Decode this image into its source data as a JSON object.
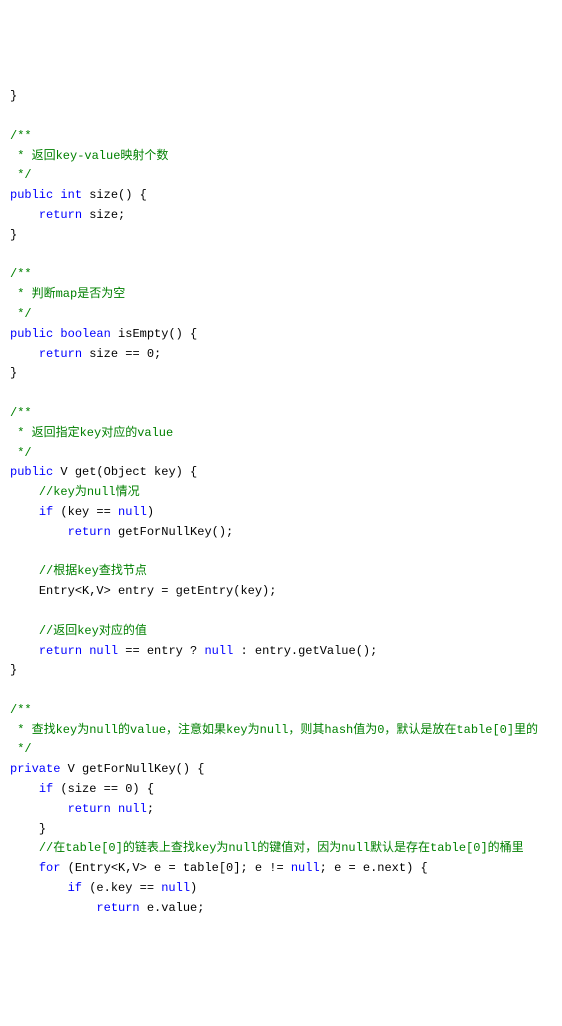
{
  "lines": [
    {
      "i": 0,
      "t": [
        {
          "c": "",
          "s": "}"
        }
      ]
    },
    {
      "i": 0,
      "t": []
    },
    {
      "i": 0,
      "t": [
        {
          "c": "cm",
          "s": "/**"
        }
      ]
    },
    {
      "i": 0,
      "t": [
        {
          "c": "cm",
          "s": " * 返回key-value映射个数"
        }
      ]
    },
    {
      "i": 0,
      "t": [
        {
          "c": "cm",
          "s": " */"
        }
      ]
    },
    {
      "i": 0,
      "t": [
        {
          "c": "kw",
          "s": "public"
        },
        {
          "c": "",
          "s": " "
        },
        {
          "c": "kw",
          "s": "int"
        },
        {
          "c": "",
          "s": " size() {"
        }
      ]
    },
    {
      "i": 1,
      "t": [
        {
          "c": "kw",
          "s": "return"
        },
        {
          "c": "",
          "s": " size;"
        }
      ]
    },
    {
      "i": 0,
      "t": [
        {
          "c": "",
          "s": "}"
        }
      ]
    },
    {
      "i": 0,
      "t": []
    },
    {
      "i": 0,
      "t": [
        {
          "c": "cm",
          "s": "/**"
        }
      ]
    },
    {
      "i": 0,
      "t": [
        {
          "c": "cm",
          "s": " * 判断map是否为空"
        }
      ]
    },
    {
      "i": 0,
      "t": [
        {
          "c": "cm",
          "s": " */"
        }
      ]
    },
    {
      "i": 0,
      "t": [
        {
          "c": "kw",
          "s": "public"
        },
        {
          "c": "",
          "s": " "
        },
        {
          "c": "kw",
          "s": "boolean"
        },
        {
          "c": "",
          "s": " isEmpty() {"
        }
      ]
    },
    {
      "i": 1,
      "t": [
        {
          "c": "kw",
          "s": "return"
        },
        {
          "c": "",
          "s": " size == 0;"
        }
      ]
    },
    {
      "i": 0,
      "t": [
        {
          "c": "",
          "s": "}"
        }
      ]
    },
    {
      "i": 0,
      "t": []
    },
    {
      "i": 0,
      "t": [
        {
          "c": "cm",
          "s": "/**"
        }
      ]
    },
    {
      "i": 0,
      "t": [
        {
          "c": "cm",
          "s": " * 返回指定key对应的value"
        }
      ]
    },
    {
      "i": 0,
      "t": [
        {
          "c": "cm",
          "s": " */"
        }
      ]
    },
    {
      "i": 0,
      "t": [
        {
          "c": "kw",
          "s": "public"
        },
        {
          "c": "",
          "s": " V get(Object key) {"
        }
      ]
    },
    {
      "i": 1,
      "t": [
        {
          "c": "cm",
          "s": "//key为null情况"
        }
      ]
    },
    {
      "i": 1,
      "t": [
        {
          "c": "kw",
          "s": "if"
        },
        {
          "c": "",
          "s": " (key == "
        },
        {
          "c": "kw",
          "s": "null"
        },
        {
          "c": "",
          "s": ")"
        }
      ]
    },
    {
      "i": 2,
      "t": [
        {
          "c": "kw",
          "s": "return"
        },
        {
          "c": "",
          "s": " getForNullKey();"
        }
      ]
    },
    {
      "i": 0,
      "t": []
    },
    {
      "i": 1,
      "t": [
        {
          "c": "cm",
          "s": "//根据key查找节点"
        }
      ]
    },
    {
      "i": 1,
      "t": [
        {
          "c": "",
          "s": "Entry<K,V> entry = getEntry(key);"
        }
      ]
    },
    {
      "i": 0,
      "t": []
    },
    {
      "i": 1,
      "t": [
        {
          "c": "cm",
          "s": "//返回key对应的值"
        }
      ]
    },
    {
      "i": 1,
      "t": [
        {
          "c": "kw",
          "s": "return"
        },
        {
          "c": "",
          "s": " "
        },
        {
          "c": "kw",
          "s": "null"
        },
        {
          "c": "",
          "s": " == entry ? "
        },
        {
          "c": "kw",
          "s": "null"
        },
        {
          "c": "",
          "s": " : entry.getValue();"
        }
      ]
    },
    {
      "i": 0,
      "t": [
        {
          "c": "",
          "s": "}"
        }
      ]
    },
    {
      "i": 0,
      "t": []
    },
    {
      "i": 0,
      "t": [
        {
          "c": "cm",
          "s": "/**"
        }
      ]
    },
    {
      "i": 0,
      "t": [
        {
          "c": "cm",
          "s": " * 查找key为null的value，注意如果key为null，则其hash值为0，默认是放在table[0]里的"
        }
      ]
    },
    {
      "i": 0,
      "t": [
        {
          "c": "cm",
          "s": " */"
        }
      ]
    },
    {
      "i": 0,
      "t": [
        {
          "c": "kw",
          "s": "private"
        },
        {
          "c": "",
          "s": " V getForNullKey() {"
        }
      ]
    },
    {
      "i": 1,
      "t": [
        {
          "c": "kw",
          "s": "if"
        },
        {
          "c": "",
          "s": " (size == 0) {"
        }
      ]
    },
    {
      "i": 2,
      "t": [
        {
          "c": "kw",
          "s": "return"
        },
        {
          "c": "",
          "s": " "
        },
        {
          "c": "kw",
          "s": "null"
        },
        {
          "c": "",
          "s": ";"
        }
      ]
    },
    {
      "i": 1,
      "t": [
        {
          "c": "",
          "s": "}"
        }
      ]
    },
    {
      "i": 1,
      "t": [
        {
          "c": "cm",
          "s": "//在table[0]的链表上查找key为null的键值对，因为null默认是存在table[0]的桶里"
        }
      ]
    },
    {
      "i": 1,
      "t": [
        {
          "c": "kw",
          "s": "for"
        },
        {
          "c": "",
          "s": " (Entry<K,V> e = table[0]; e != "
        },
        {
          "c": "kw",
          "s": "null"
        },
        {
          "c": "",
          "s": "; e = e.next) {"
        }
      ]
    },
    {
      "i": 2,
      "t": [
        {
          "c": "kw",
          "s": "if"
        },
        {
          "c": "",
          "s": " (e.key == "
        },
        {
          "c": "kw",
          "s": "null"
        },
        {
          "c": "",
          "s": ")"
        }
      ]
    },
    {
      "i": 3,
      "t": [
        {
          "c": "kw",
          "s": "return"
        },
        {
          "c": "",
          "s": " e.value;"
        }
      ]
    }
  ]
}
